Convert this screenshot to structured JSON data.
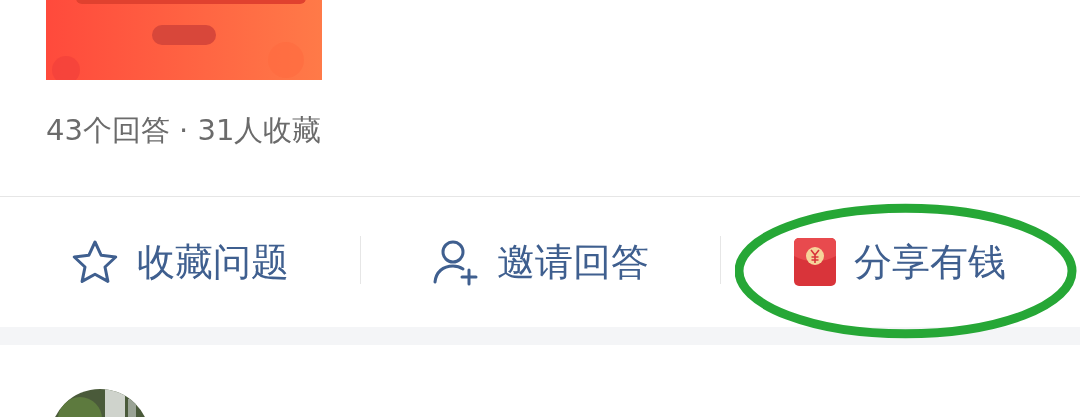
{
  "stats": "43个回答 · 31人收藏",
  "actions": [
    {
      "kind": "star",
      "label": "收藏问题",
      "highlighted": false
    },
    {
      "kind": "invite",
      "label": "邀请回答",
      "highlighted": false
    },
    {
      "kind": "redpacket",
      "label": "分享有钱",
      "highlighted": true
    }
  ]
}
